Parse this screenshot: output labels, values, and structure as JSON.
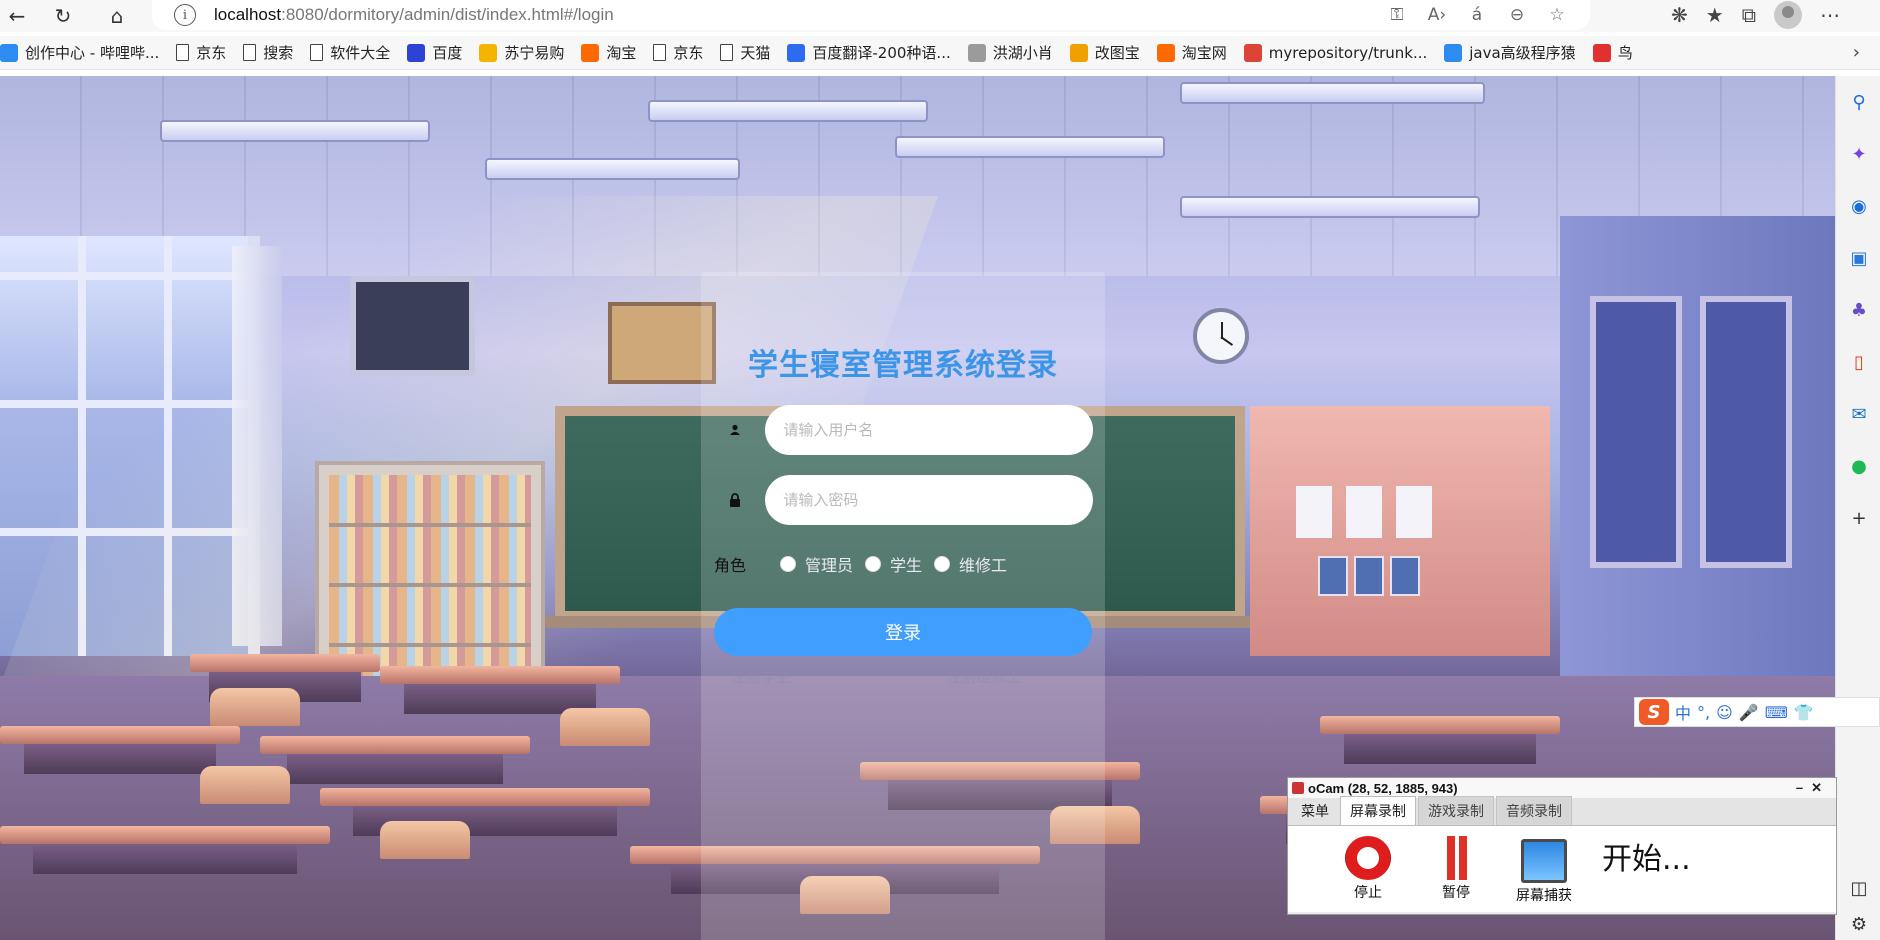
{
  "browser": {
    "url_host": "localhost",
    "url_rest": ":8080/dormitory/admin/dist/index.html#/login"
  },
  "bookmarks": [
    {
      "label": "创作中心 - 哔哩哔...",
      "icon": "bilibili-icon",
      "color": "#2c8cf0"
    },
    {
      "label": "京东",
      "icon": "file-icon"
    },
    {
      "label": "搜索",
      "icon": "file-icon"
    },
    {
      "label": "软件大全",
      "icon": "file-icon"
    },
    {
      "label": "百度",
      "icon": "baidu-paw-icon",
      "color": "#2d43d4"
    },
    {
      "label": "苏宁易购",
      "icon": "suning-icon",
      "color": "#f5b400"
    },
    {
      "label": "淘宝",
      "icon": "taobao-icon",
      "color": "#ff6a00"
    },
    {
      "label": "京东",
      "icon": "file-icon"
    },
    {
      "label": "天猫",
      "icon": "file-icon"
    },
    {
      "label": "百度翻译-200种语...",
      "icon": "translate-icon",
      "color": "#2e6bf0"
    },
    {
      "label": "洪湖小肖",
      "icon": "feather-icon",
      "color": "#9b9b9b"
    },
    {
      "label": "改图宝",
      "icon": "gaitubao-icon",
      "color": "#f0a000"
    },
    {
      "label": "淘宝网",
      "icon": "taobao-icon",
      "color": "#ff6a00"
    },
    {
      "label": "myrepository/trunk...",
      "icon": "chrome-icon",
      "color": "#db4437"
    },
    {
      "label": "java高级程序猿",
      "icon": "bilibili-tv-icon",
      "color": "#2c8cf0"
    },
    {
      "label": "鸟",
      "icon": "bird-icon",
      "color": "#e03030"
    }
  ],
  "login": {
    "title": "学生寝室管理系统登录",
    "username_placeholder": "请输入用户名",
    "password_placeholder": "请输入密码",
    "role_label": "角色",
    "roles": [
      "管理员",
      "学生",
      "维修工"
    ],
    "login_button": "登录",
    "register_student": "注册学生",
    "register_worker": "注册维修工"
  },
  "ime": {
    "items": [
      "中",
      "°,",
      "☺",
      "🎤",
      "⌨",
      "👕"
    ]
  },
  "ocam": {
    "title": "oCam (28, 52, 1885, 943)",
    "tabs": [
      "菜单",
      "屏幕录制",
      "游戏录制",
      "音频录制"
    ],
    "active_tab": "屏幕录制",
    "tools": [
      "停止",
      "暂停",
      "屏幕捕获"
    ],
    "status": "开始..."
  },
  "colors": {
    "accent": "#409eff",
    "title_blue": "#3d95ea"
  }
}
